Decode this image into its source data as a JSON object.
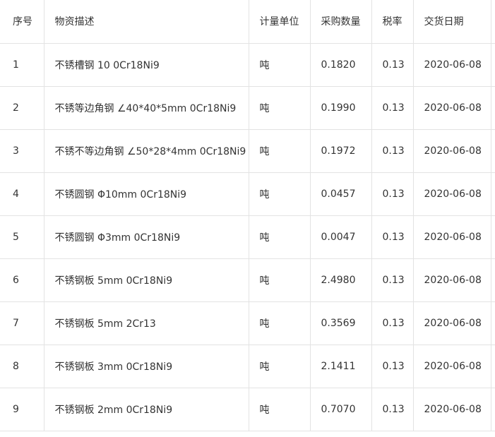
{
  "table": {
    "headers": {
      "index": "序号",
      "description": "物资描述",
      "unit": "计量单位",
      "quantity": "采购数量",
      "tax_rate": "税率",
      "delivery_date": "交货日期"
    },
    "rows": [
      {
        "index": "1",
        "description": "不锈槽钢 10 0Cr18Ni9",
        "unit": "吨",
        "quantity": "0.1820",
        "tax_rate": "0.13",
        "delivery_date": "2020-06-08"
      },
      {
        "index": "2",
        "description": "不锈等边角钢 ∠40*40*5mm 0Cr18Ni9",
        "unit": "吨",
        "quantity": "0.1990",
        "tax_rate": "0.13",
        "delivery_date": "2020-06-08"
      },
      {
        "index": "3",
        "description": "不锈不等边角钢 ∠50*28*4mm 0Cr18Ni9",
        "unit": "吨",
        "quantity": "0.1972",
        "tax_rate": "0.13",
        "delivery_date": "2020-06-08"
      },
      {
        "index": "4",
        "description": "不锈圆钢 Φ10mm 0Cr18Ni9",
        "unit": "吨",
        "quantity": "0.0457",
        "tax_rate": "0.13",
        "delivery_date": "2020-06-08"
      },
      {
        "index": "5",
        "description": "不锈圆钢 Φ3mm 0Cr18Ni9",
        "unit": "吨",
        "quantity": "0.0047",
        "tax_rate": "0.13",
        "delivery_date": "2020-06-08"
      },
      {
        "index": "6",
        "description": "不锈钢板 5mm 0Cr18Ni9",
        "unit": "吨",
        "quantity": "2.4980",
        "tax_rate": "0.13",
        "delivery_date": "2020-06-08"
      },
      {
        "index": "7",
        "description": "不锈钢板 5mm 2Cr13",
        "unit": "吨",
        "quantity": "0.3569",
        "tax_rate": "0.13",
        "delivery_date": "2020-06-08"
      },
      {
        "index": "8",
        "description": "不锈钢板 3mm 0Cr18Ni9",
        "unit": "吨",
        "quantity": "2.1411",
        "tax_rate": "0.13",
        "delivery_date": "2020-06-08"
      },
      {
        "index": "9",
        "description": "不锈钢板 2mm 0Cr18Ni9",
        "unit": "吨",
        "quantity": "0.7070",
        "tax_rate": "0.13",
        "delivery_date": "2020-06-08"
      }
    ]
  }
}
